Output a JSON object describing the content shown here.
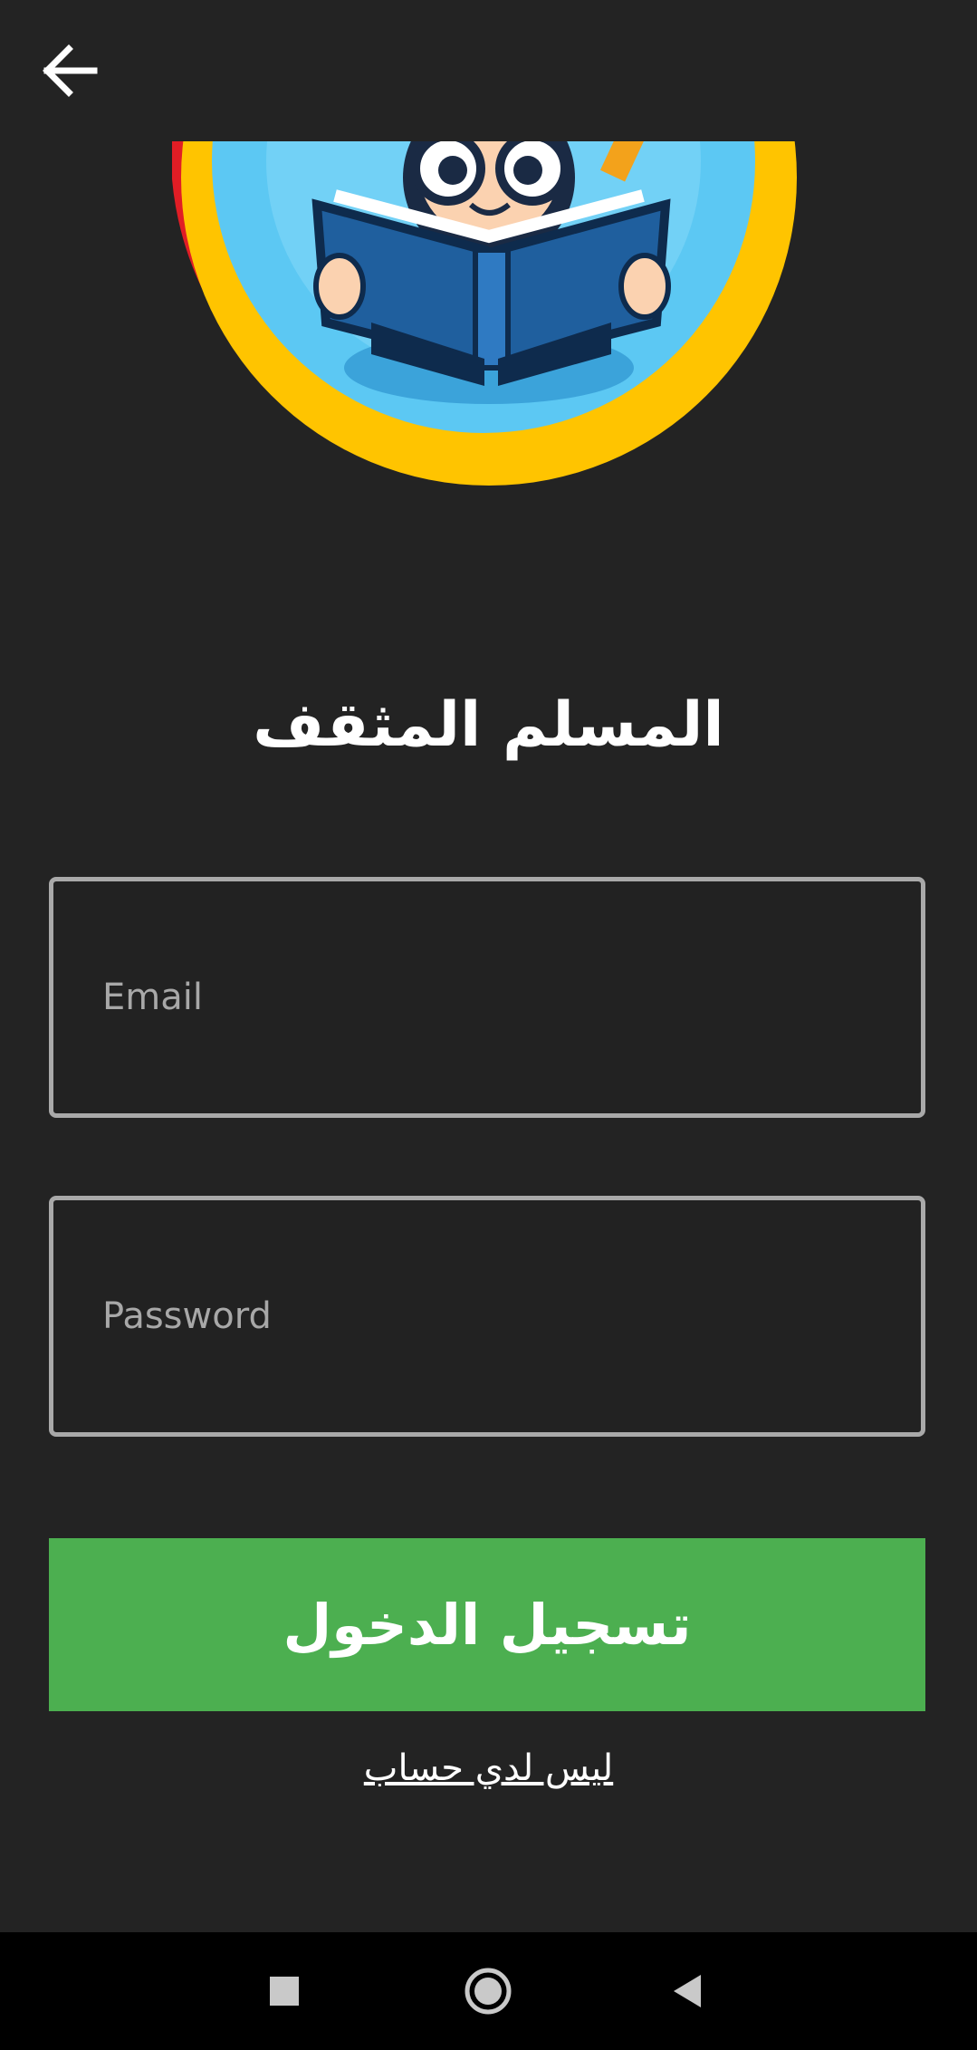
{
  "app": {
    "title": "المسلم المثقف"
  },
  "form": {
    "email_placeholder": "Email",
    "email_value": "",
    "password_placeholder": "Password",
    "password_value": "",
    "login_label": "تسجيل الدخول",
    "signup_link": "ليس لدي حساب"
  },
  "icons": {
    "back": "back-arrow-icon",
    "logo": "reading-child-logo",
    "nav_recents": "square-icon",
    "nav_home": "circle-icon",
    "nav_back": "triangle-back-icon"
  },
  "colors": {
    "background": "#232323",
    "accent": "#4caf50",
    "field_border": "#a9a9a9",
    "nav_bar": "#000000"
  }
}
